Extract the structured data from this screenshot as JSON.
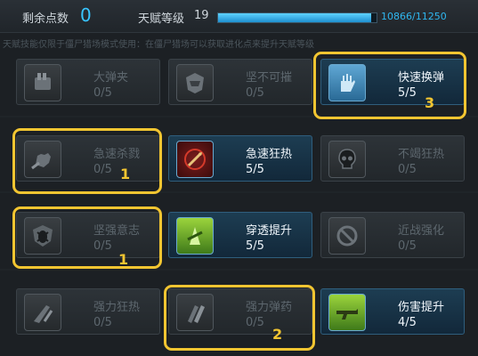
{
  "header": {
    "points_label": "剩余点数",
    "points_value": "0",
    "level_label": "天赋等级",
    "level_value": "19",
    "xp_text": "10866/11250",
    "xp_fraction": 0.966
  },
  "notice": "天赋技能仅限于僵尸猎场模式使用：在僵尸猎场可以获取进化点来提升天赋等级",
  "talents": [
    {
      "name": "大弹夹",
      "value": "0/5",
      "icon": "magazine-icon",
      "active": false
    },
    {
      "name": "坚不可摧",
      "value": "0/5",
      "icon": "armor-icon",
      "active": false
    },
    {
      "name": "快速换弹",
      "value": "5/5",
      "icon": "hand-reload-icon",
      "active": true
    },
    {
      "name": "急速杀戮",
      "value": "0/5",
      "icon": "fist-icon",
      "active": false
    },
    {
      "name": "急速狂热",
      "value": "5/5",
      "icon": "frenzy-icon",
      "active": true
    },
    {
      "name": "不竭狂热",
      "value": "0/5",
      "icon": "skull-icon",
      "active": false
    },
    {
      "name": "坚强意志",
      "value": "0/5",
      "icon": "beetle-shield-icon",
      "active": false
    },
    {
      "name": "穿透提升",
      "value": "5/5",
      "icon": "penetration-icon",
      "active": true
    },
    {
      "name": "近战强化",
      "value": "0/5",
      "icon": "melee-icon",
      "active": false
    },
    {
      "name": "强力狂热",
      "value": "0/5",
      "icon": "power-frenzy-icon",
      "active": false
    },
    {
      "name": "强力弹药",
      "value": "0/5",
      "icon": "power-ammo-icon",
      "active": false
    },
    {
      "name": "伤害提升",
      "value": "4/5",
      "icon": "damage-gun-icon",
      "active": true
    }
  ],
  "annotations": [
    "3",
    "1",
    "1",
    "2"
  ],
  "colors": {
    "accent": "#38c5ff",
    "highlight": "#f2c531",
    "active_card": "#1d3d52",
    "inactive_card": "#2d3338"
  }
}
